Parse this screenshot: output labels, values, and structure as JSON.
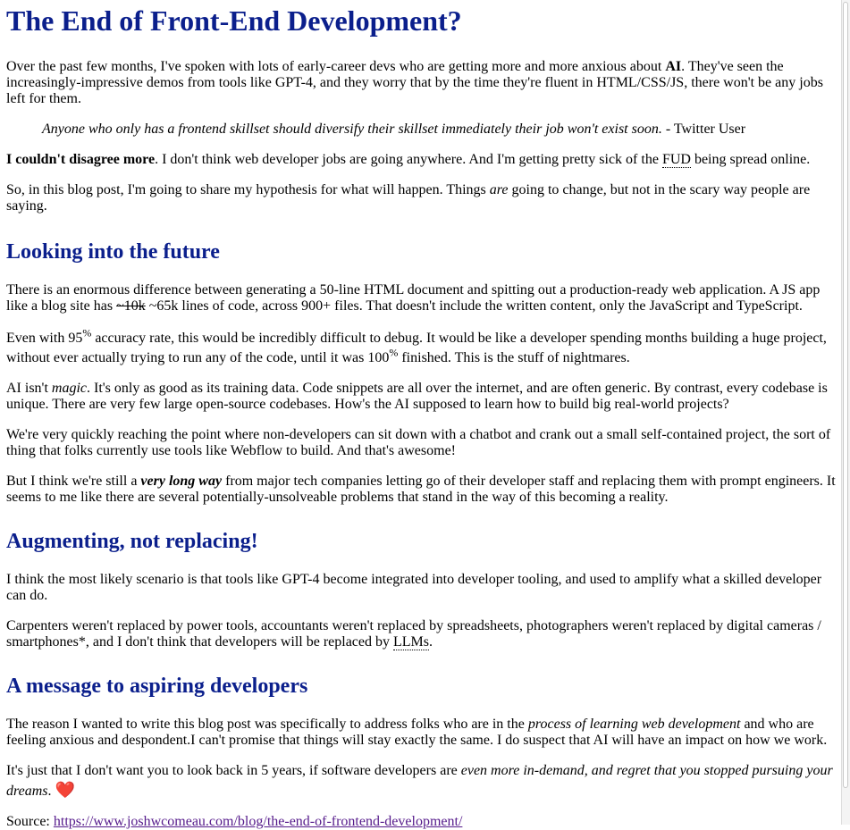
{
  "title": "The End of Front-End Development?",
  "intro": {
    "t1": "Over the past few months, I've spoken with lots of early-career devs who are getting more and more anxious about ",
    "ai": "AI",
    "t2": ". They've seen the increasingly-impressive demos from tools like GPT-4, and they worry that by the time they're fluent in HTML/CSS/JS, there won't be any jobs left for them."
  },
  "quote": {
    "text": "Anyone who only has a frontend skillset should diversify their skillset immediately their job won't exist soon.",
    "attribution": " - Twitter User"
  },
  "disagree": {
    "bold": "I couldn't disagree more",
    "t1": ". I don't think web developer jobs are going anywhere. And I'm getting pretty sick of the ",
    "fud": "FUD",
    "t2": " being spread online."
  },
  "hypothesis": {
    "t1": "So, in this blog post, I'm going to share my hypothesis for what will happen. Things ",
    "em": "are",
    "t2": " going to change, but not in the scary way people are saying."
  },
  "section1": {
    "heading": "Looking into the future",
    "p1": {
      "t1": "There is an enormous difference between generating a 50-line HTML document and spitting out a production-ready web application. A JS app like a blog site has ",
      "strike": "~10k",
      "t2": " ~65k lines of code, across 900+ files. That doesn't include the written content, only the JavaScript and TypeScript."
    },
    "p2": {
      "t1": "Even with 95",
      "pct1": "%",
      "t2": " accuracy rate, this would be incredibly difficult to debug. It would be like a developer spending months building a huge project, without ever actually trying to run any of the code, until it was 100",
      "pct2": "%",
      "t3": " finished. This is the stuff of nightmares."
    },
    "p3": {
      "t1": "AI isn't ",
      "em": "magic",
      "t2": ". It's only as good as its training data. Code snippets are all over the internet, and are often generic. By contrast, every codebase is unique. There are very few large open-source codebases. How's the AI supposed to learn how to build big real-world projects?"
    },
    "p4": "We're very quickly reaching the point where non-developers can sit down with a chatbot and crank out a small self-contained project, the sort of thing that folks currently use tools like Webflow to build. And that's awesome!",
    "p5": {
      "t1": "But I think we're still a ",
      "strong": "very long way",
      "t2": " from major tech companies letting go of their developer staff and replacing them with prompt engineers. It seems to me like there are several potentially-unsolveable problems that stand in the way of this becoming a reality."
    }
  },
  "section2": {
    "heading": "Augmenting, not replacing!",
    "p1": "I think the most likely scenario is that tools like GPT-4 become integrated into developer tooling, and used to amplify what a skilled developer can do.",
    "p2": {
      "t1": "Carpenters weren't replaced by power tools, accountants weren't replaced by spreadsheets, photographers weren't replaced by digital cameras / smartphones*, and I don't think that developers will be replaced by ",
      "llm": "LLMs",
      "t2": "."
    }
  },
  "section3": {
    "heading": "A message to aspiring developers",
    "p1": {
      "t1": "The reason I wanted to write this blog post was specifically to address folks who are in the ",
      "em": "process of learning web development",
      "t2": " and who are feeling anxious and despondent.I can't promise that things will stay exactly the same. I do suspect that AI will have an impact on how we work."
    },
    "p2": {
      "t1": "It's just that I don't want you to look back in 5 years, if software developers are ",
      "em": "even more in-demand, and regret that you stopped pursuing your dreams",
      "t2": ". ",
      "heart": "❤️"
    }
  },
  "source": {
    "label": "Source: ",
    "url": "https://www.joshwcomeau.com/blog/the-end-of-frontend-development/"
  }
}
